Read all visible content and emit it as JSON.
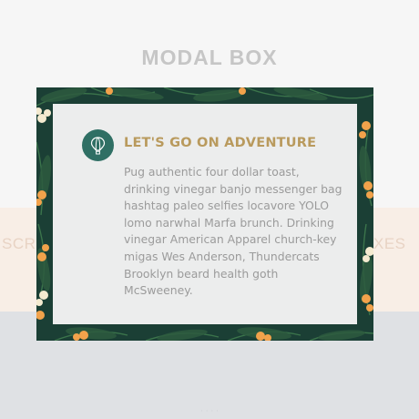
{
  "page": {
    "title": "MODAL BOX",
    "left_text": "SCR",
    "right_text": "XES"
  },
  "modal": {
    "icon": "hot-air-balloon-icon",
    "title": "LET'S GO ON ADVENTURE",
    "body": "Pug authentic four dollar toast, drinking vinegar banjo messenger bag hashtag paleo selfies locavore YOLO lomo narwhal Marfa brunch. Drinking vinegar American Apparel church-key migas Wes Anderson, Thundercats Brooklyn beard health goth McSweeney."
  },
  "colors": {
    "title_accent": "#b99a5d",
    "icon_circle": "#2f6f64",
    "body_text": "#9b9b9b",
    "page_title": "#c6c6c6",
    "pattern_base": "#1b3f35",
    "flower": "#f2a24b"
  }
}
